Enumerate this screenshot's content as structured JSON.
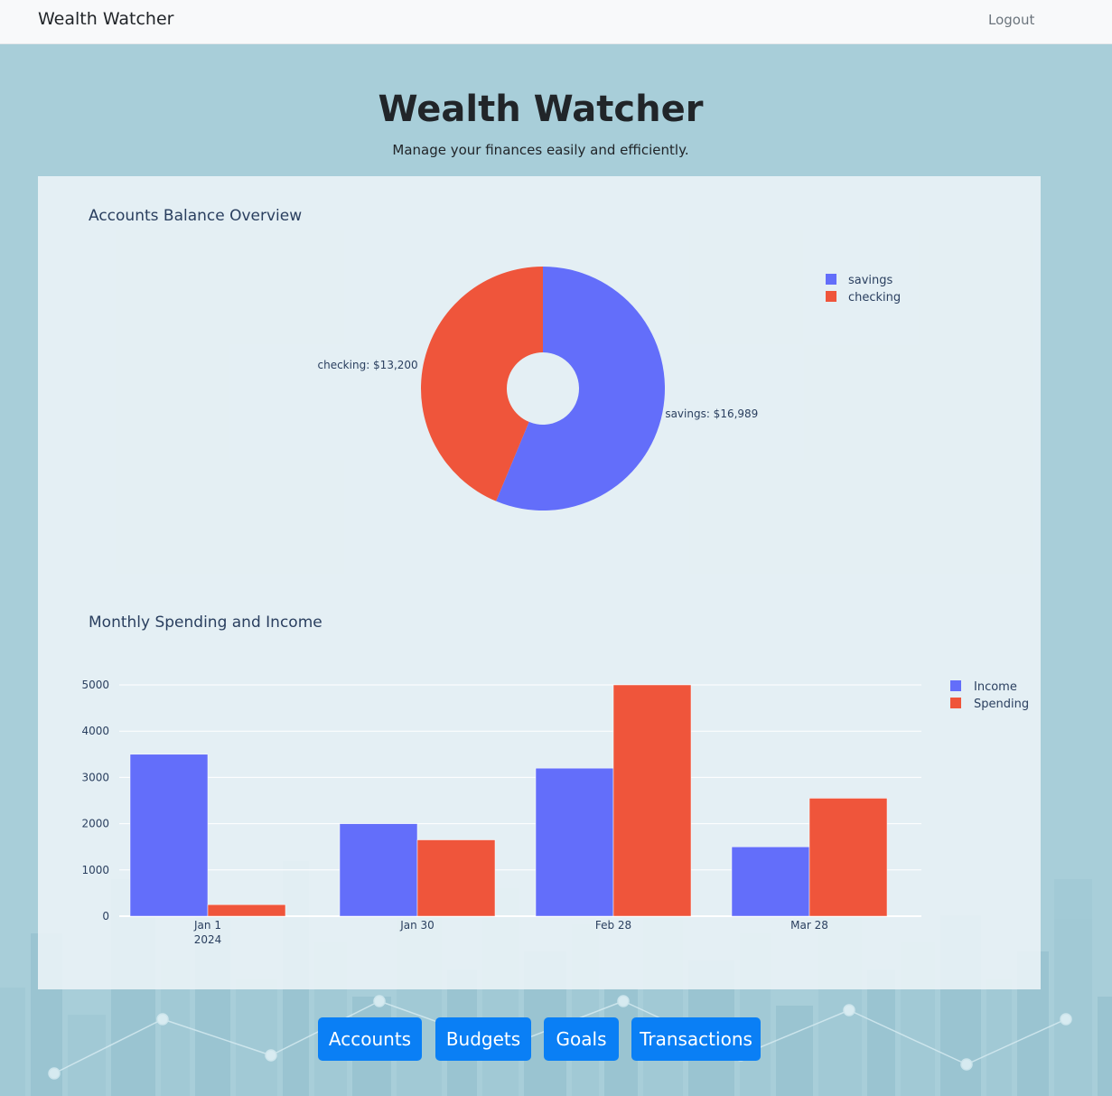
{
  "nav": {
    "brand": "Wealth Watcher",
    "logout": "Logout"
  },
  "hero": {
    "title": "Wealth Watcher",
    "subtitle": "Manage your finances easily and efficiently."
  },
  "buttons": [
    "Accounts",
    "Budgets",
    "Goals",
    "Transactions"
  ],
  "colors": {
    "button": "#0a7ff5",
    "series1": "#636efa",
    "series2": "#ef553b"
  },
  "chart_data": [
    {
      "type": "pie",
      "title": "Accounts Balance Overview",
      "labels": [
        "savings",
        "checking"
      ],
      "values": [
        16989,
        13200
      ],
      "slice_labels": [
        "savings: $16,989",
        "checking: $13,200"
      ],
      "hole": 0.3,
      "legend": "top-right"
    },
    {
      "type": "bar",
      "title": "Monthly Spending and Income",
      "x": [
        "Jan 1\n2024",
        "Jan 30",
        "Feb 28",
        "Mar 28"
      ],
      "tick_labels": [
        "Jan 1",
        "Jan 30",
        "Feb 28",
        "Mar 28"
      ],
      "tick_sublabel": "2024",
      "series": [
        {
          "name": "Income",
          "values": [
            3500,
            2000,
            3200,
            1500
          ]
        },
        {
          "name": "Spending",
          "values": [
            250,
            1650,
            5000,
            2550
          ]
        }
      ],
      "yticks": [
        0,
        1000,
        2000,
        3000,
        4000,
        5000
      ],
      "ylim": [
        0,
        5000
      ],
      "grid": true,
      "legend": "top-right"
    }
  ]
}
